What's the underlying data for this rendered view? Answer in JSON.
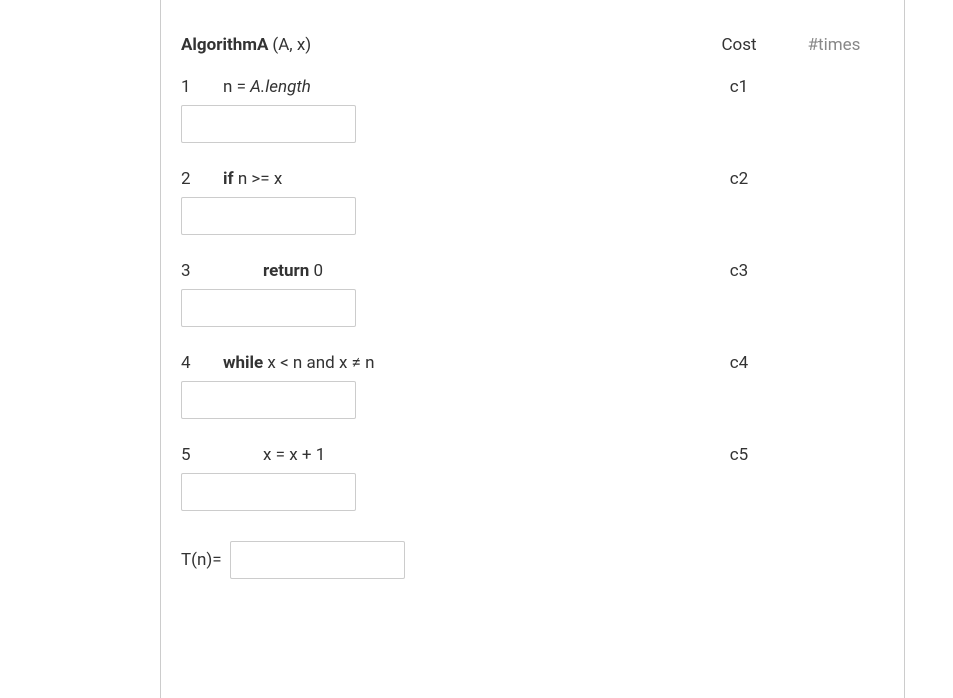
{
  "header": {
    "title": "AlgorithmA",
    "params": "(A, x)",
    "cost_label": "Cost",
    "times_label": "#times"
  },
  "lines": [
    {
      "num": "1",
      "prefix": "",
      "mid": "n = ",
      "suffix": "A.length",
      "cost": "c1",
      "indent": 1
    },
    {
      "num": "2",
      "prefix": "if ",
      "mid": "n >= x",
      "suffix": "",
      "cost": "c2",
      "indent": 1
    },
    {
      "num": "3",
      "prefix": "return ",
      "mid": "0",
      "suffix": "",
      "cost": "c3",
      "indent": 2
    },
    {
      "num": "4",
      "prefix": "while ",
      "mid": "x < n and x ≠ n",
      "suffix": "",
      "cost": "c4",
      "indent": 1
    },
    {
      "num": "5",
      "prefix": "",
      "mid": "x = x + 1",
      "suffix": "",
      "cost": "c5",
      "indent": 2
    }
  ],
  "tn": {
    "label": "T(n)="
  }
}
